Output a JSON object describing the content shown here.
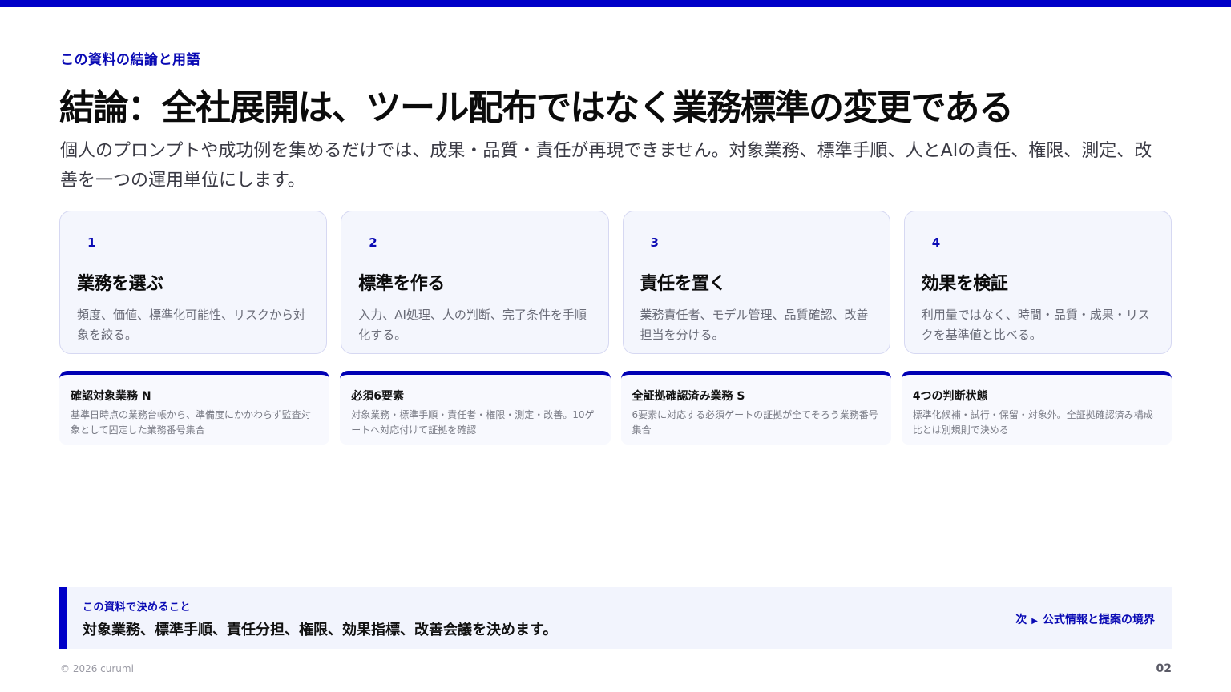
{
  "header": {
    "eyebrow": "この資料の結論と用語",
    "title": "結論：全社展開は、ツール配布ではなく業務標準の変更である",
    "lead": "個人のプロンプトや成功例を集めるだけでは、成果・品質・責任が再現できません。対象業務、標準手順、人とAIの責任、権限、測定、改善を一つの運用単位にします。"
  },
  "steps": [
    {
      "num": "1",
      "title": "業務を選ぶ",
      "desc": "頻度、価値、標準化可能性、リスクから対象を絞る。"
    },
    {
      "num": "2",
      "title": "標準を作る",
      "desc": "入力、AI処理、人の判断、完了条件を手順化する。"
    },
    {
      "num": "3",
      "title": "責任を置く",
      "desc": "業務責任者、モデル管理、品質確認、改善担当を分ける。"
    },
    {
      "num": "4",
      "title": "効果を検証",
      "desc": "利用量ではなく、時間・品質・成果・リスクを基準値と比べる。"
    }
  ],
  "terms": [
    {
      "title": "確認対象業務 N",
      "desc": "基準日時点の業務台帳から、準備度にかかわらず監査対象として固定した業務番号集合"
    },
    {
      "title": "必須6要素",
      "desc": "対象業務・標準手順・責任者・権限・測定・改善。10ゲートへ対応付けて証拠を確認"
    },
    {
      "title": "全証拠確認済み業務 S",
      "desc": "6要素に対応する必須ゲートの証拠が全てそろう業務番号集合"
    },
    {
      "title": "4つの判断状態",
      "desc": "標準化候補・試行・保留・対象外。全証拠確認済み構成比とは別規則で決める"
    }
  ],
  "decision": {
    "label": "この資料で決めること",
    "text": "対象業務、標準手順、責任分担、権限、効果指標、改善会議を決めます。",
    "next_arrow": "▶",
    "next_label": "次",
    "next_target": "公式情報と提案の境界"
  },
  "footer": {
    "copyright": "© 2026 curumi",
    "page": "02"
  },
  "colors": {
    "accent": "#0000c8",
    "card_bg": "#f4f6fd",
    "card_border": "#d6d8f2"
  }
}
